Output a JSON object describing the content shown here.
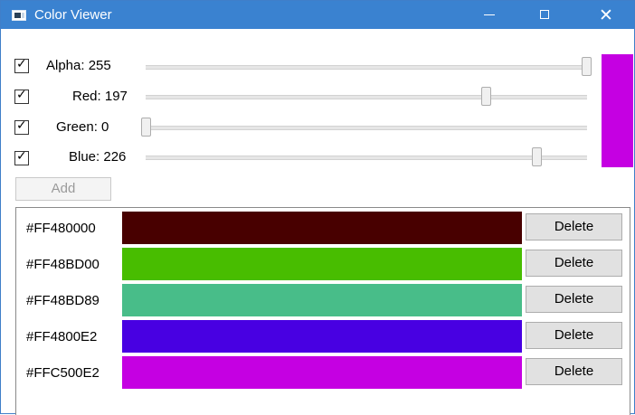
{
  "window": {
    "title": "Color Viewer",
    "close_glyph": "✕"
  },
  "channels": [
    {
      "label": "Alpha: 255",
      "checked": true,
      "value": 255,
      "max": 255
    },
    {
      "label": "Red: 197",
      "checked": true,
      "value": 197,
      "max": 255
    },
    {
      "label": "Green:  0",
      "checked": true,
      "value": 0,
      "max": 255
    },
    {
      "label": "Blue: 226",
      "checked": true,
      "value": 226,
      "max": 255
    }
  ],
  "preview_color": "#C500E2",
  "check_glyph": "✓",
  "add_label": "Add",
  "delete_label": "Delete",
  "colors": [
    {
      "hex": "#FF480000",
      "swatch": "#480000"
    },
    {
      "hex": "#FF48BD00",
      "swatch": "#48BD00"
    },
    {
      "hex": "#FF48BD89",
      "swatch": "#48BD89"
    },
    {
      "hex": "#FF4800E2",
      "swatch": "#4800E2"
    },
    {
      "hex": "#FFC500E2",
      "swatch": "#C500E2"
    }
  ]
}
